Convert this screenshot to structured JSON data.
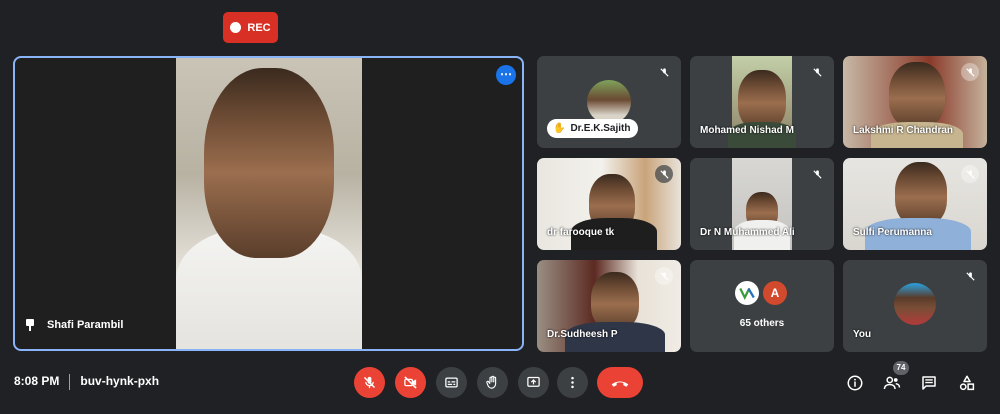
{
  "recording": {
    "label": "REC"
  },
  "main_speaker": {
    "name": "Shafi Parambil"
  },
  "participants": [
    {
      "name": "Dr.E.K.Sajith"
    },
    {
      "name": "Mohamed Nishad M"
    },
    {
      "name": "Lakshmi R Chandran"
    },
    {
      "name": "dr farooque tk"
    },
    {
      "name": "Dr N Muhammed Ali"
    },
    {
      "name": "Sulfi Perumanna"
    },
    {
      "name": "Dr.Sudheesh P"
    },
    {
      "name": "65 others",
      "avatar_initial": "A"
    },
    {
      "name": "You"
    }
  ],
  "meeting": {
    "time": "8:08 PM",
    "code": "buv-hynk-pxh"
  },
  "people_count": "74",
  "colors": {
    "accent": "#8ab4f8",
    "danger": "#ea4335",
    "background": "#202124",
    "tile": "#3c4043"
  }
}
